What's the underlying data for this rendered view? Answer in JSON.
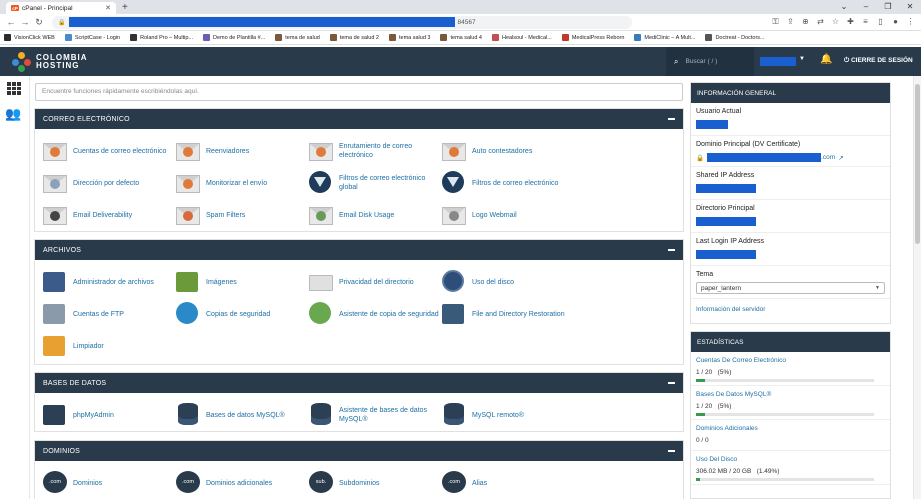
{
  "browser": {
    "tab_title": "cPanel - Principal",
    "favicon_text": "cP",
    "url_port": "84567",
    "bookmarks": [
      {
        "label": "VisionClick WEB",
        "color": "#2b2b2b"
      },
      {
        "label": "ScriptCase - Login",
        "color": "#4a8bc9"
      },
      {
        "label": "Roland Pro – Multip...",
        "color": "#333333"
      },
      {
        "label": "Demo de Plantilla #...",
        "color": "#6b5fb5"
      },
      {
        "label": "tema de salud",
        "color": "#7a5a3a"
      },
      {
        "label": "tema de salud 2",
        "color": "#7a5a3a"
      },
      {
        "label": "tema salud 3",
        "color": "#7a5a3a"
      },
      {
        "label": "tema salud 4",
        "color": "#7a5a3a"
      },
      {
        "label": "Healsoul - Medical...",
        "color": "#c14f4f"
      },
      {
        "label": "MedicalPress Reborn",
        "color": "#c0392b"
      },
      {
        "label": "MediClinic – A Mult...",
        "color": "#3a7ab8"
      },
      {
        "label": "Doctreat - Doctors...",
        "color": "#555555"
      }
    ]
  },
  "header": {
    "logo_line1": "COLOMBIA",
    "logo_line2": "HOSTING",
    "search_placeholder": "Buscar ( / )",
    "logout_label": "CIERRE DE SESIÓN"
  },
  "main": {
    "feature_search_placeholder": "Encuentre funciones rápidamente escribiéndolas aquí.",
    "sections": {
      "email": {
        "title": "CORREO ELECTRÓNICO",
        "items": [
          "Cuentas de correo electrónico",
          "Reenviadores",
          "Enrutamiento de correo electrónico",
          "Auto contestadores",
          "Dirección por defecto",
          "Monitorizar el envío",
          "Filtros de correo electrónico global",
          "Filtros de correo electrónico",
          "Email Deliverability",
          "Spam Filters",
          "Email Disk Usage",
          "Logo Webmail"
        ]
      },
      "files": {
        "title": "ARCHIVOS",
        "items": [
          "Administrador de archivos",
          "Imágenes",
          "Privacidad del directorio",
          "Uso del disco",
          "Cuentas de FTP",
          "Copias de seguridad",
          "Asistente de copia de seguridad",
          "File and Directory Restoration",
          "Limpiador"
        ]
      },
      "databases": {
        "title": "BASES DE DATOS",
        "items": [
          "phpMyAdmin",
          "Bases de datos MySQL®",
          "Asistente de bases de datos MySQL®",
          "MySQL remoto®"
        ]
      },
      "domains": {
        "title": "DOMINIOS",
        "items": [
          "Dominios",
          "Dominios adicionales",
          "Subdominios",
          "Alias"
        ],
        "icon_texts": [
          ".com",
          ".com",
          "sub.",
          ".com"
        ]
      }
    }
  },
  "sidebar": {
    "general": {
      "title": "INFORMACIÓN GENERAL",
      "current_user_label": "Usuario Actual",
      "primary_domain_label": "Dominio Principal (DV Certificate)",
      "primary_domain_suffix": ".com",
      "shared_ip_label": "Shared IP Address",
      "home_dir_label": "Directorio Principal",
      "last_login_label": "Last Login IP Address",
      "theme_label": "Tema",
      "theme_value": "paper_lantern",
      "server_info_link": "Información del servidor"
    },
    "stats": {
      "title": "ESTADÍSTICAS",
      "items": [
        {
          "label": "Cuentas De Correo Electrónico",
          "value": "1 / 20   (5%)",
          "percent": 5
        },
        {
          "label": "Bases De Datos MySQL®",
          "value": "1 / 20   (5%)",
          "percent": 5
        },
        {
          "label": "Dominios Adicionales",
          "value": "0 / 0",
          "percent": 0
        },
        {
          "label": "Uso Del Disco",
          "value": "306.02 MB / 20 GB   (1.49%)",
          "percent": 1.49
        }
      ]
    }
  }
}
